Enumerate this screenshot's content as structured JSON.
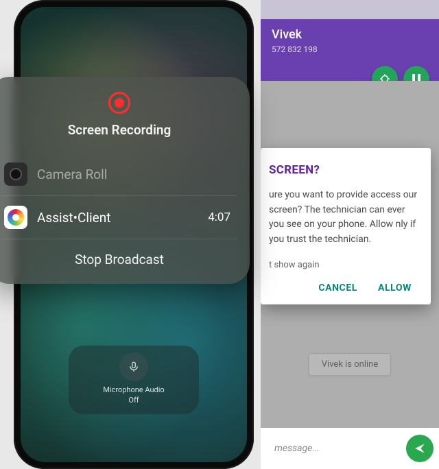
{
  "android": {
    "header": {
      "name": "Vivek",
      "code": "572 832 198"
    },
    "online_text": "Vivek is online",
    "message_placeholder": "message...",
    "dialog": {
      "title": "SCREEN?",
      "body": "ure you want to provide access our screen? The technician can ever you see on your phone. Allow nly if you trust the technician.",
      "checkbox_label": "t show again",
      "cancel": "CANCEL",
      "allow": "ALLOW"
    }
  },
  "iphone": {
    "mic": {
      "line1": "Microphone Audio",
      "line2": "Off"
    },
    "sheet": {
      "title": "Screen Recording",
      "camera_roll": "Camera Roll",
      "assist_client": "Assist•Client",
      "time": "4:07",
      "stop": "Stop Broadcast"
    }
  }
}
